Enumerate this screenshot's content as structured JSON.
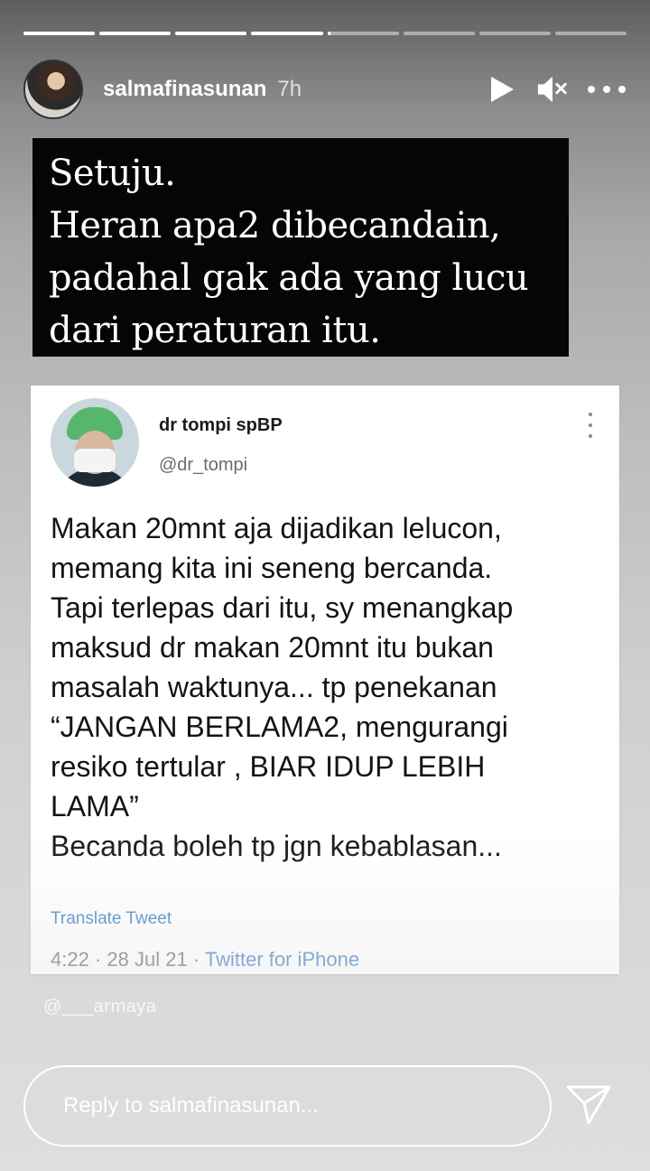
{
  "story": {
    "segments_total": 8,
    "segments_watched": 4,
    "current_segment_progress": 0.05,
    "username": "salmafinasunan",
    "time_ago": "7h"
  },
  "caption": {
    "lines": [
      "Setuju.",
      "Heran apa2 dibecandain,",
      "padahal gak ada yang lucu",
      "dari peraturan itu."
    ]
  },
  "tweet": {
    "name": "dr tompi spBP",
    "handle": "@dr_tompi",
    "lines": [
      "Makan 20mnt aja dijadikan lelucon,",
      "memang kita ini seneng bercanda.",
      "Tapi terlepas dari itu, sy menangkap",
      "maksud dr makan 20mnt itu bukan",
      "masalah waktunya... tp penekanan",
      "“JANGAN BERLAMA2, mengurangi",
      "resiko tertular , BIAR IDUP LEBIH",
      "LAMA”",
      "Becanda boleh tp jgn kebablasan..."
    ],
    "translate_label": "Translate Tweet",
    "time": "4:22",
    "date": "28 Jul 21",
    "separator": "·",
    "source": "Twitter for iPhone"
  },
  "watermark": "@___armaya",
  "reply": {
    "placeholder": "Reply to salmafinasunan..."
  },
  "icons": {
    "play": "play-icon",
    "mute": "speaker-muted-icon",
    "more": "more-horizontal-icon",
    "send": "send-icon",
    "tweet_more": "more-vertical-icon"
  }
}
